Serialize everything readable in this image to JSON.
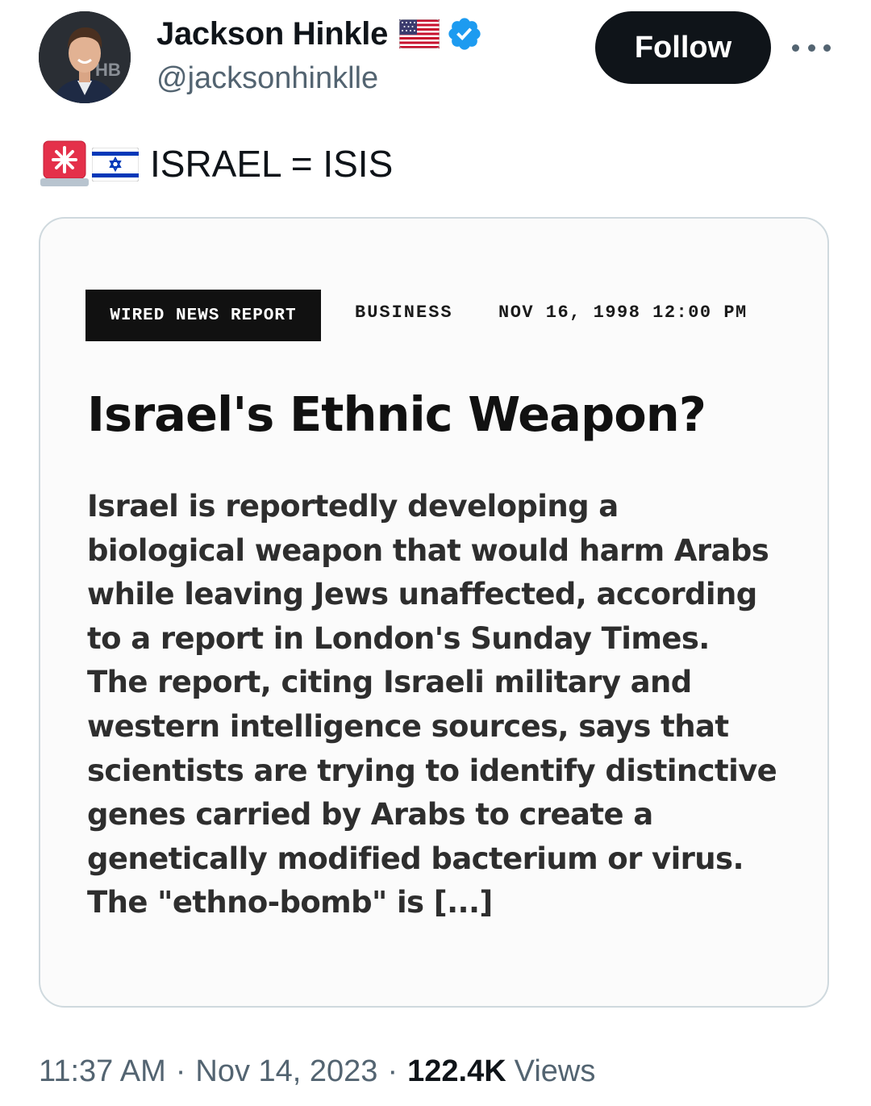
{
  "author": {
    "display_name": "Jackson Hinkle",
    "handle": "@jacksonhinklle",
    "avatar_icon": "profile-photo",
    "flag_icon": "us-flag",
    "verified_icon": "verified-badge",
    "verified_color": "#1d9bf0"
  },
  "actions": {
    "follow_label": "Follow",
    "more_icon": "more-horizontal"
  },
  "tweet": {
    "emoji_icons": [
      "police-siren",
      "israel-flag"
    ],
    "text": "ISRAEL = ISIS"
  },
  "media": {
    "badge": "WIRED NEWS REPORT",
    "section": "BUSINESS",
    "date": "NOV 16, 1998 12:00 PM",
    "headline": "Israel's Ethnic Weapon?",
    "body_lines": [
      "Israel is reportedly developing a",
      "biological weapon that would harm Arabs",
      "while leaving Jews unaffected, according",
      "to a report in London's Sunday Times.",
      "The report, citing Israeli military and",
      "western intelligence sources, says that",
      "scientists are trying to identify distinctive",
      "genes carried by Arabs to create a",
      "genetically modified bacterium or virus.",
      "The \"ethno-bomb\" is [...]"
    ]
  },
  "meta": {
    "time": "11:37 AM",
    "separator": "·",
    "date": "Nov 14, 2023",
    "views_count": "122.4K",
    "views_label": "Views"
  },
  "colors": {
    "text_primary": "#0f1419",
    "text_secondary": "#536471",
    "follow_bg": "#0f1419",
    "card_border": "#cfd9de"
  }
}
